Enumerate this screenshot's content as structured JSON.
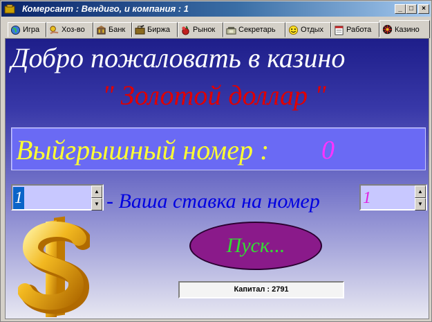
{
  "window": {
    "title": "Комерсант : Вендиго, и компания : 1",
    "minimize": "_",
    "maximize": "□",
    "close": "×"
  },
  "tabs": [
    {
      "label": "Игра",
      "icon": "globe-icon"
    },
    {
      "label": "Хоз-во",
      "icon": "hand-coins-icon"
    },
    {
      "label": "Банк",
      "icon": "bank-icon"
    },
    {
      "label": "Биржа",
      "icon": "briefcase-icon"
    },
    {
      "label": "Рынок",
      "icon": "market-bag-icon"
    },
    {
      "label": "Секретарь",
      "icon": "phone-icon"
    },
    {
      "label": "Отдых",
      "icon": "smiley-icon"
    },
    {
      "label": "Работа",
      "icon": "calendar-icon"
    },
    {
      "label": "Казино",
      "icon": "roulette-icon",
      "active": true
    }
  ],
  "casino": {
    "welcome": "Добро пожаловать в казино",
    "name": "\" Золотой доллар \"",
    "winning_label": "Выйгрышный номер :",
    "winning_number": "0",
    "stake": "1",
    "bet_text": "- Ваша ставка на номер",
    "bet_number": "1",
    "start_button": "Пуск...",
    "capital": "Капитал : 2791"
  },
  "colors": {
    "accent": "#0a246a",
    "win_panel": "#6a6af4",
    "title_red": "#e00000",
    "button": "#8a1a8a"
  }
}
